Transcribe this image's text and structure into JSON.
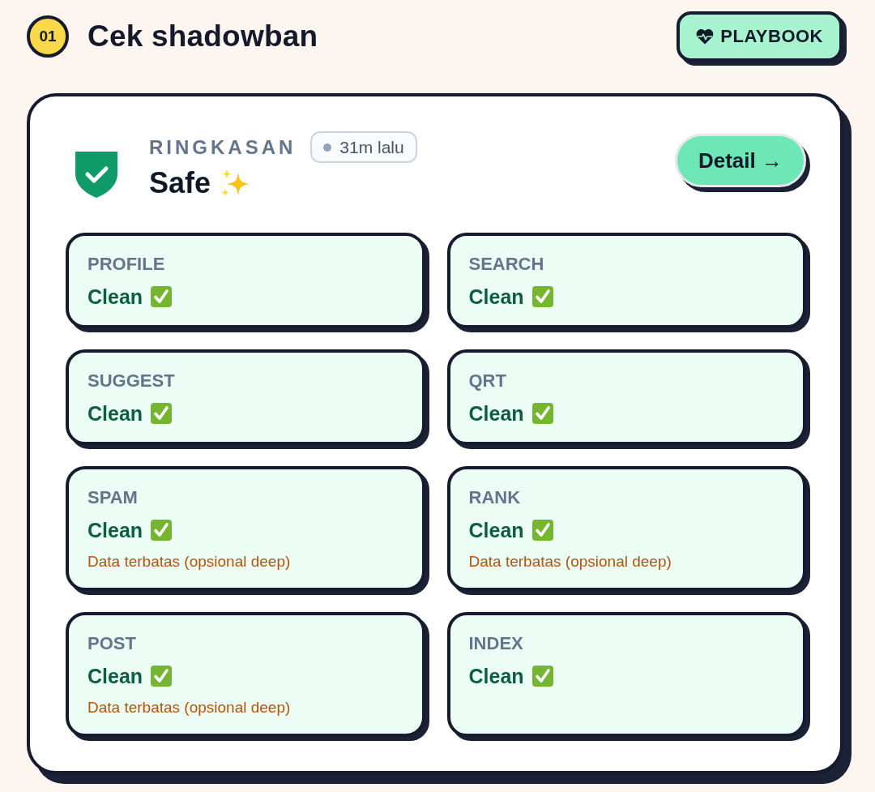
{
  "header": {
    "step": "01",
    "title": "Cek shadowban",
    "playbook_button": "PLAYBOOK"
  },
  "summary": {
    "label": "RINGKASAN",
    "time": "31m lalu",
    "status": "Safe",
    "detail_button": "Detail →"
  },
  "checks": [
    {
      "label": "PROFILE",
      "result": "Clean",
      "passed": true
    },
    {
      "label": "SEARCH",
      "result": "Clean",
      "passed": true
    },
    {
      "label": "SUGGEST",
      "result": "Clean",
      "passed": true
    },
    {
      "label": "QRT",
      "result": "Clean",
      "passed": true
    },
    {
      "label": "SPAM",
      "result": "Clean",
      "passed": true,
      "note": "Data terbatas (opsional deep)"
    },
    {
      "label": "RANK",
      "result": "Clean",
      "passed": true,
      "note": "Data terbatas (opsional deep)"
    },
    {
      "label": "POST",
      "result": "Clean",
      "passed": true,
      "note": "Data terbatas (opsional deep)"
    },
    {
      "label": "INDEX",
      "result": "Clean",
      "passed": true
    }
  ]
}
